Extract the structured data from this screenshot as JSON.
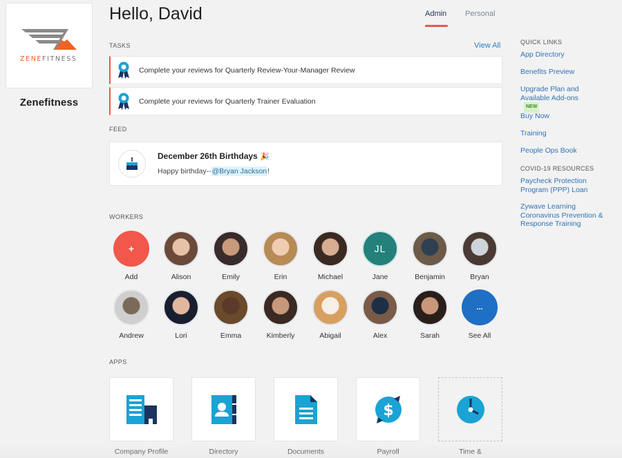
{
  "company": {
    "logo_text_left": "ZENE",
    "logo_text_right": "FITNESS",
    "name": "Zenefitness"
  },
  "header": {
    "greeting": "Hello, David",
    "tabs": [
      {
        "label": "Admin",
        "active": true
      },
      {
        "label": "Personal",
        "active": false
      }
    ]
  },
  "tasks": {
    "label": "TASKS",
    "view_all": "View All",
    "items": [
      {
        "icon": "award-ribbon-icon",
        "text": "Complete your reviews for Quarterly Review-Your-Manager Review"
      },
      {
        "icon": "award-ribbon-icon",
        "text": "Complete your reviews for Quarterly Trainer Evaluation"
      }
    ]
  },
  "feed": {
    "label": "FEED",
    "items": [
      {
        "icon": "birthday-cake-icon",
        "title": "December 26th Birthdays",
        "title_emoji": "🎉",
        "body_prefix": "Happy birthday--",
        "mention": "@Bryan Jackson",
        "body_suffix": "!"
      }
    ]
  },
  "workers": {
    "label": "WORKERS",
    "items": [
      {
        "name": "Add",
        "type": "add",
        "glyph": "+",
        "color": "#f2574b"
      },
      {
        "name": "Alison",
        "type": "photo"
      },
      {
        "name": "Emily",
        "type": "photo"
      },
      {
        "name": "Erin",
        "type": "photo"
      },
      {
        "name": "Michael",
        "type": "photo"
      },
      {
        "name": "Jane",
        "type": "initials",
        "initials": "JL",
        "color": "#23807b"
      },
      {
        "name": "Benjamin",
        "type": "photo"
      },
      {
        "name": "Bryan",
        "type": "photo"
      },
      {
        "name": "Andrew",
        "type": "photo"
      },
      {
        "name": "Lori",
        "type": "photo"
      },
      {
        "name": "Emma",
        "type": "photo"
      },
      {
        "name": "Kimberly",
        "type": "photo"
      },
      {
        "name": "Abigail",
        "type": "photo"
      },
      {
        "name": "Alex",
        "type": "photo"
      },
      {
        "name": "Sarah",
        "type": "photo"
      },
      {
        "name": "See All",
        "type": "more",
        "glyph": "...",
        "color": "#1f6fc4"
      }
    ]
  },
  "apps": {
    "label": "APPS",
    "items": [
      {
        "label": "Company Profile",
        "icon": "building-icon"
      },
      {
        "label": "Directory",
        "icon": "address-book-icon"
      },
      {
        "label": "Documents",
        "icon": "document-icon"
      },
      {
        "label": "Payroll",
        "icon": "payroll-dollar-icon"
      },
      {
        "label": "Time &",
        "icon": "clock-icon"
      }
    ]
  },
  "quick_links": {
    "label": "QUICK LINKS",
    "items": [
      {
        "label": "App Directory"
      },
      {
        "label": "Benefits Preview"
      },
      {
        "label": "Upgrade Plan and Available Add-ons",
        "badge": "NEW"
      },
      {
        "label": "Buy Now"
      },
      {
        "label": "Training"
      },
      {
        "label": "People Ops Book"
      }
    ]
  },
  "covid_resources": {
    "label": "COVID-19 RESOURCES",
    "items": [
      {
        "label": "Paycheck Protection Program (PPP) Loan"
      },
      {
        "label": "Zywave Learning Coronavirus Prevention & Response Training"
      }
    ]
  },
  "colors": {
    "accent_red": "#e5584f",
    "link_blue": "#2f73b4",
    "icon_cyan": "#1aa3d4",
    "icon_navy": "#1a3461",
    "logo_orange": "#f06225",
    "logo_gray": "#808080"
  }
}
